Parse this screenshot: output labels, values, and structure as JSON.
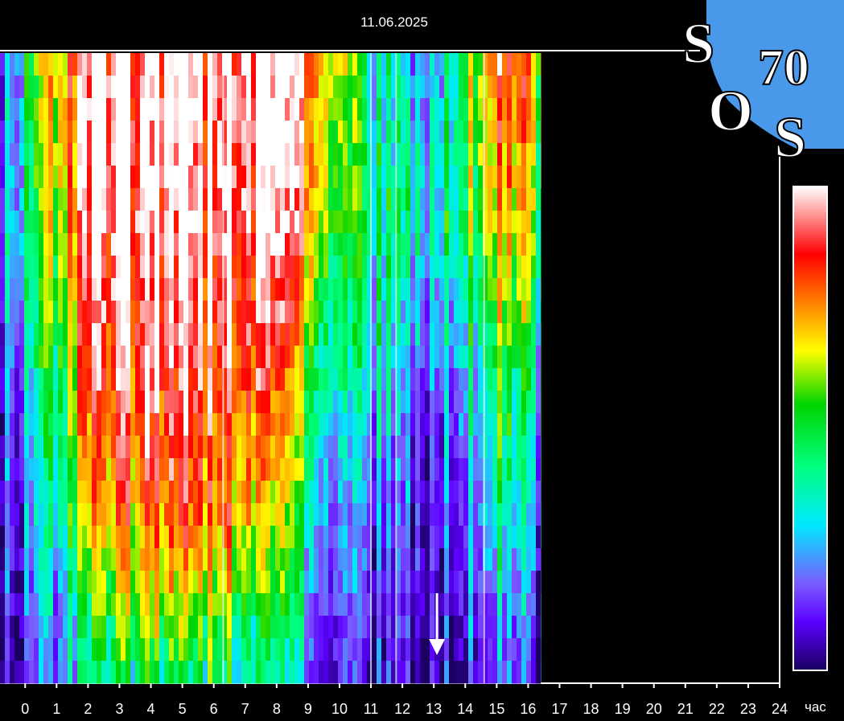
{
  "header": {
    "date": "11.06.2025"
  },
  "logo": {
    "letters": [
      "S",
      "70",
      "O",
      "S"
    ],
    "bg_color": "#4a98ea"
  },
  "chart_data": {
    "type": "heatmap",
    "title": "",
    "xlabel": "час",
    "ylabel": "",
    "x_ticks": [
      0,
      1,
      2,
      3,
      4,
      5,
      6,
      7,
      8,
      9,
      10,
      11,
      12,
      13,
      14,
      15,
      16,
      17,
      18,
      19,
      20,
      21,
      22,
      23,
      24
    ],
    "x_range": [
      -0.8,
      24
    ],
    "data_end_hour": 16.4,
    "colorscale": [
      "#1a0060",
      "#5b00ff",
      "#7a5cff",
      "#00e8ff",
      "#00ff80",
      "#00d400",
      "#ffff00",
      "#ff8000",
      "#ff0000",
      "#ffffff"
    ],
    "intensity_by_band": {
      "hours": [
        -0.8,
        0,
        1,
        2,
        3,
        4,
        5,
        6,
        7,
        8,
        9,
        10,
        11,
        12,
        13,
        14,
        15,
        16,
        16.4
      ],
      "bands": [
        {
          "level": "top",
          "values": [
            0.2,
            0.4,
            0.75,
            0.97,
            0.99,
            0.99,
            0.99,
            0.99,
            0.99,
            0.98,
            0.9,
            0.6,
            0.4,
            0.3,
            0.3,
            0.55,
            0.85,
            0.8,
            0.6
          ]
        },
        {
          "level": "upper",
          "values": [
            0.25,
            0.4,
            0.7,
            0.95,
            0.99,
            0.98,
            0.98,
            0.98,
            0.97,
            0.95,
            0.85,
            0.5,
            0.45,
            0.4,
            0.4,
            0.5,
            0.75,
            0.7,
            0.5
          ]
        },
        {
          "level": "middle",
          "values": [
            0.2,
            0.3,
            0.55,
            0.85,
            0.9,
            0.93,
            0.92,
            0.92,
            0.88,
            0.8,
            0.6,
            0.35,
            0.35,
            0.25,
            0.25,
            0.35,
            0.55,
            0.5,
            0.35
          ]
        },
        {
          "level": "lower",
          "values": [
            0.15,
            0.2,
            0.4,
            0.65,
            0.75,
            0.8,
            0.78,
            0.8,
            0.7,
            0.6,
            0.45,
            0.2,
            0.2,
            0.15,
            0.15,
            0.2,
            0.4,
            0.35,
            0.2
          ]
        },
        {
          "level": "bottom",
          "values": [
            0.1,
            0.12,
            0.25,
            0.4,
            0.45,
            0.5,
            0.45,
            0.5,
            0.4,
            0.35,
            0.25,
            0.1,
            0.1,
            0.08,
            0.08,
            0.12,
            0.2,
            0.18,
            0.1
          ]
        }
      ]
    },
    "annotations": [
      {
        "type": "arrow",
        "x": 13.1,
        "direction": "down",
        "color": "#ffffff"
      }
    ],
    "legend": {
      "type": "colorbar",
      "placement": "right"
    }
  }
}
